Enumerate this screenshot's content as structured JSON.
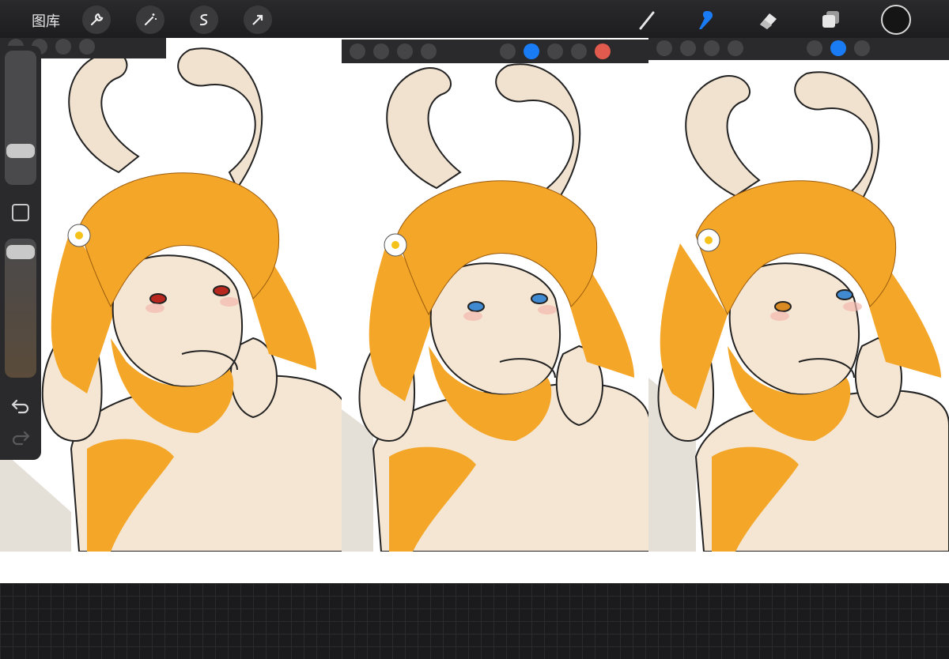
{
  "toolbar": {
    "gallery_label": "图库",
    "left_tools": [
      "wrench-icon",
      "magic-wand-icon",
      "selection-s-icon",
      "arrow-transform-icon"
    ],
    "right_tools": [
      "brush-icon",
      "smudge-icon",
      "eraser-icon",
      "layers-icon"
    ],
    "active_tool": "smudge-icon",
    "accent_color": "#1a7cf5",
    "current_color": "#151515"
  },
  "sidebar": {
    "brush_size_level": 0.74,
    "opacity_level": 1.0,
    "buttons": [
      "modify-square",
      "undo-icon",
      "redo-icon"
    ]
  },
  "panels": [
    {
      "eye_color": "#b8281e"
    },
    {
      "eye_color": "#3f8ad1"
    },
    {
      "eye_color_left": "#d98a22",
      "eye_color_right": "#3f8ad1"
    }
  ],
  "colors": {
    "fur": "#f3a628",
    "skin": "#f5e6d3",
    "horn": "#f1e2d0",
    "line": "#222222",
    "mini_swatch": "#e15a4e"
  }
}
